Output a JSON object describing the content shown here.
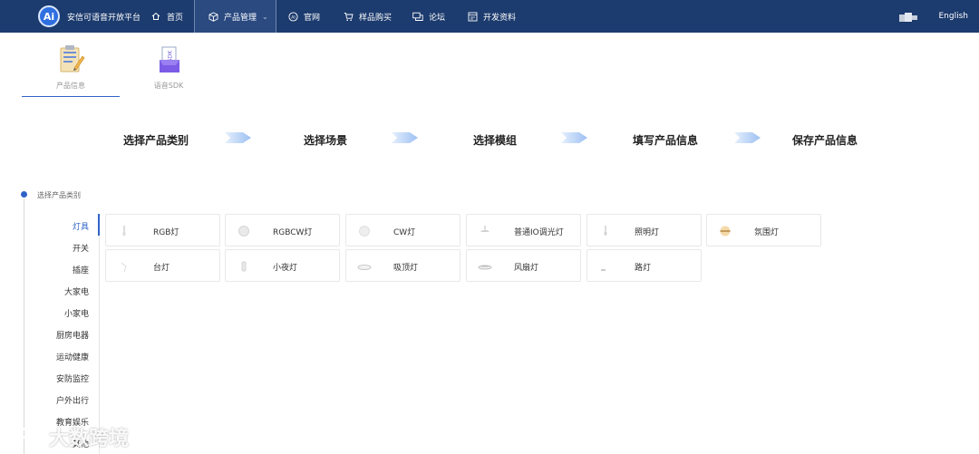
{
  "brand": {
    "logo_text": "Ai",
    "title": "安信可语音开放平台"
  },
  "nav": [
    {
      "label": "首页",
      "icon": "home-icon"
    },
    {
      "label": "产品管理",
      "icon": "cube-icon",
      "active": true,
      "has_dropdown": true
    },
    {
      "label": "官网",
      "icon": "ai-circle-icon"
    },
    {
      "label": "样品购买",
      "icon": "cart-icon"
    },
    {
      "label": "论坛",
      "icon": "chat-icon"
    },
    {
      "label": "开发资料",
      "icon": "document-icon"
    }
  ],
  "language": "English",
  "tabs": [
    {
      "label": "产品信息",
      "icon": "product-info-icon",
      "active": true
    },
    {
      "label": "语音SDK",
      "icon": "sdk-icon",
      "active": false
    }
  ],
  "steps": [
    "选择产品类别",
    "选择场景",
    "选择模组",
    "填写产品信息",
    "保存产品信息"
  ],
  "section_label": "选择产品类别",
  "categories": [
    {
      "label": "灯具",
      "active": true
    },
    {
      "label": "开关"
    },
    {
      "label": "插座"
    },
    {
      "label": "大家电"
    },
    {
      "label": "小家电"
    },
    {
      "label": "厨房电器"
    },
    {
      "label": "运动健康"
    },
    {
      "label": "安防监控"
    },
    {
      "label": "户外出行"
    },
    {
      "label": "教育娱乐"
    },
    {
      "label": "其他"
    }
  ],
  "products": [
    [
      {
        "label": "RGB灯",
        "icon": "bulb-icon"
      },
      {
        "label": "RGBCW灯",
        "icon": "round-lamp-icon"
      },
      {
        "label": "CW灯",
        "icon": "round-lamp-icon"
      },
      {
        "label": "普通IO调光灯",
        "icon": "pendant-lamp-icon"
      },
      {
        "label": "照明灯",
        "icon": "bulb-icon"
      },
      {
        "label": "氛围灯",
        "icon": "ambient-lamp-icon"
      }
    ],
    [
      {
        "label": "台灯",
        "icon": "desk-lamp-icon"
      },
      {
        "label": "小夜灯",
        "icon": "night-light-icon"
      },
      {
        "label": "吸顶灯",
        "icon": "ceiling-lamp-icon"
      },
      {
        "label": "风扇灯",
        "icon": "fan-lamp-icon"
      },
      {
        "label": "路灯",
        "icon": "street-lamp-icon"
      }
    ]
  ],
  "watermark": "大数跨境",
  "colors": {
    "nav_bg": "#1c3b6e",
    "accent": "#2f63c7",
    "arrow": "#a9c8f5"
  }
}
